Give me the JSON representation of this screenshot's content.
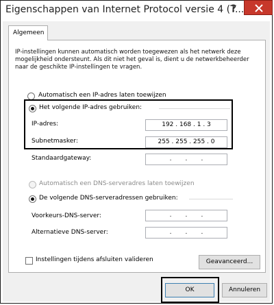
{
  "window": {
    "title": "Eigenschappen van Internet Protocol versie 4 (T...",
    "help_glyph": "?",
    "close_icon": "close-icon"
  },
  "tabs": [
    {
      "label": "Algemeen",
      "selected": true
    }
  ],
  "description": "IP-instellingen kunnen automatisch worden toegewezen als het netwerk deze mogelijkheid ondersteunt. Als dit niet het geval is, dient u de netwerkbeheerder naar de geschikte IP-instellingen te vragen.",
  "ip_section": {
    "auto_label": "Automatisch een IP-adres laten toewijzen",
    "manual_label": "Het volgende IP-adres gebruiken:",
    "fields": {
      "ip_label": "IP-adres:",
      "ip_value": "192 . 168 . 1 . 3",
      "subnet_label": "Subnetmasker:",
      "subnet_value": "255 . 255 . 255 . 0",
      "gateway_label": "Standaardgateway:",
      "gateway_value": ".       .       ."
    }
  },
  "dns_section": {
    "auto_label": "Automatisch een DNS-serveradres laten toewijzen",
    "manual_label": "De volgende DNS-serveradressen gebruiken:",
    "preferred_label": "Voorkeurs-DNS-server:",
    "preferred_value": ".       .       .",
    "alternate_label": "Alternatieve DNS-server:",
    "alternate_value": ".       .       ."
  },
  "validate_label": "Instellingen tijdens afsluiten valideren",
  "buttons": {
    "advanced": "Geavanceerd...",
    "ok": "OK",
    "cancel": "Annuleren"
  },
  "colors": {
    "close_button": "#c7382b",
    "highlight_box": "#000000"
  }
}
